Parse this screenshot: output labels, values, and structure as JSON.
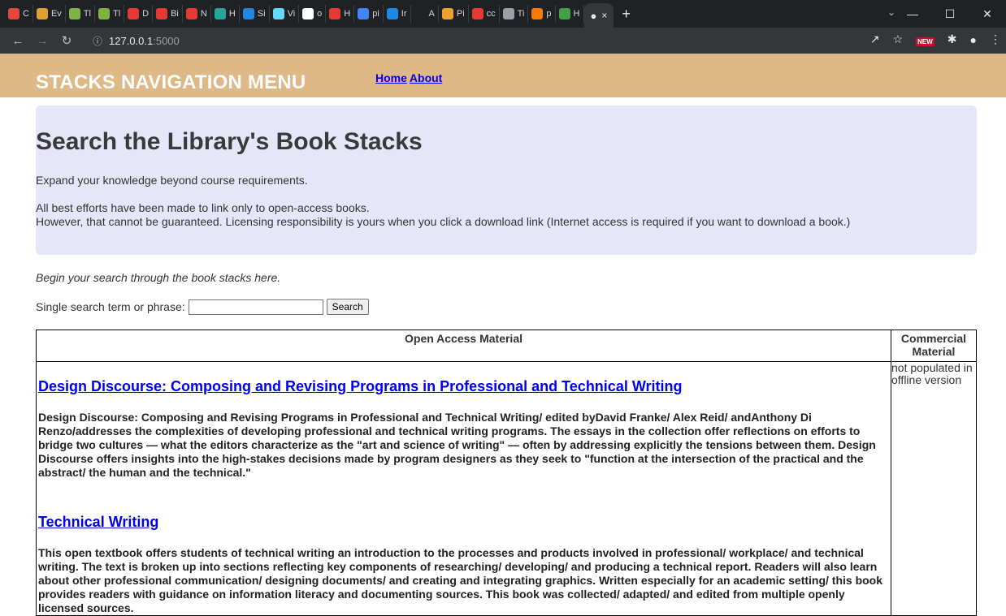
{
  "browser": {
    "tabs": [
      {
        "label": "C",
        "icon": "bars-icon",
        "color": "#e8453c"
      },
      {
        "label": "Ev",
        "icon": "star-icon",
        "color": "#e0a030"
      },
      {
        "label": "Tl",
        "icon": "doc-icon",
        "color": "#7cb342"
      },
      {
        "label": "Tl",
        "icon": "doc-icon",
        "color": "#7cb342"
      },
      {
        "label": "D",
        "icon": "rocket-icon",
        "color": "#e53935"
      },
      {
        "label": "Bi",
        "icon": "rocket-icon",
        "color": "#e53935"
      },
      {
        "label": "N",
        "icon": "rocket-icon",
        "color": "#e53935"
      },
      {
        "label": "H",
        "icon": "square-icon",
        "color": "#26a69a"
      },
      {
        "label": "Si",
        "icon": "sitm-icon",
        "color": "#1e88e5"
      },
      {
        "label": "Vi",
        "icon": "react-icon",
        "color": "#61dafb"
      },
      {
        "label": "o",
        "icon": "wordpress-icon",
        "color": "#ffffff"
      },
      {
        "label": "H",
        "icon": "pc-icon",
        "color": "#e53935"
      },
      {
        "label": "pi",
        "icon": "google-icon",
        "color": "#4285f4"
      },
      {
        "label": "Ir",
        "icon": "globe-icon",
        "color": "#1e88e5"
      },
      {
        "label": "A",
        "icon": "blank-icon",
        "color": "#202124"
      },
      {
        "label": "Pi",
        "icon": "image-icon",
        "color": "#f0a030"
      },
      {
        "label": "cc",
        "icon": "counter-icon",
        "color": "#e53935"
      },
      {
        "label": "Ti",
        "icon": "atom-icon",
        "color": "#9aa0a6"
      },
      {
        "label": "p",
        "icon": "java-icon",
        "color": "#f57c00"
      },
      {
        "label": "H",
        "icon": "w-icon",
        "color": "#43a047"
      }
    ],
    "active_tab": {
      "label": "",
      "close": "×"
    },
    "new_tab": "+",
    "url_host": "127.0.0.1",
    "url_port": ":5000",
    "new_badge": "NEW"
  },
  "page": {
    "brand": "STACKS NAVIGATION MENU",
    "nav_links": [
      "Home",
      "About"
    ],
    "hero": {
      "title": "Search the Library's Book Stacks",
      "subtitle": "Expand your knowledge beyond course requirements.",
      "notice_line1": "All best efforts have been made to link only to open-access books.",
      "notice_line2": "However, that cannot be guaranteed. Licensing responsibility is yours when you click a download link (Internet access is required if you want to download a book.)"
    },
    "begin_text": "Begin your search through the book stacks here.",
    "search": {
      "label": "Single search term or phrase:",
      "value": "",
      "button": "Search"
    },
    "table": {
      "col_open": "Open Access Material",
      "col_commercial": "Commercial Material",
      "commercial_note": "not populated in offline version",
      "books": [
        {
          "title": "Design Discourse: Composing and Revising Programs in Professional and Technical Writing",
          "description": "Design Discourse: Composing and Revising Programs in Professional and Technical Writing/ edited byDavid Franke/ Alex Reid/ andAnthony Di Renzo/addresses the complexities of developing professional and technical writing programs. The essays in the collection offer reflections on efforts to bridge two cultures — what the editors characterize as the \"art and science of writing\" — often by addressing explicitly the tensions between them. Design Discourse offers insights into the high-stakes decisions made by program designers as they seek to \"function at the intersection of the practical and the abstract/ the human and the technical.\""
        },
        {
          "title": "Technical Writing",
          "description": "This open textbook offers students of technical writing an introduction to the processes and products involved in professional/ workplace/ and technical writing. The text is broken up into sections reflecting key components of researching/ developing/ and producing a technical report. Readers will also learn about other professional communication/ designing documents/ and creating and integrating graphics. Written especially for an academic setting/ this book provides readers with guidance on information literacy and documenting sources. This book was collected/ adapted/ and edited from multiple openly licensed sources."
        }
      ]
    }
  }
}
